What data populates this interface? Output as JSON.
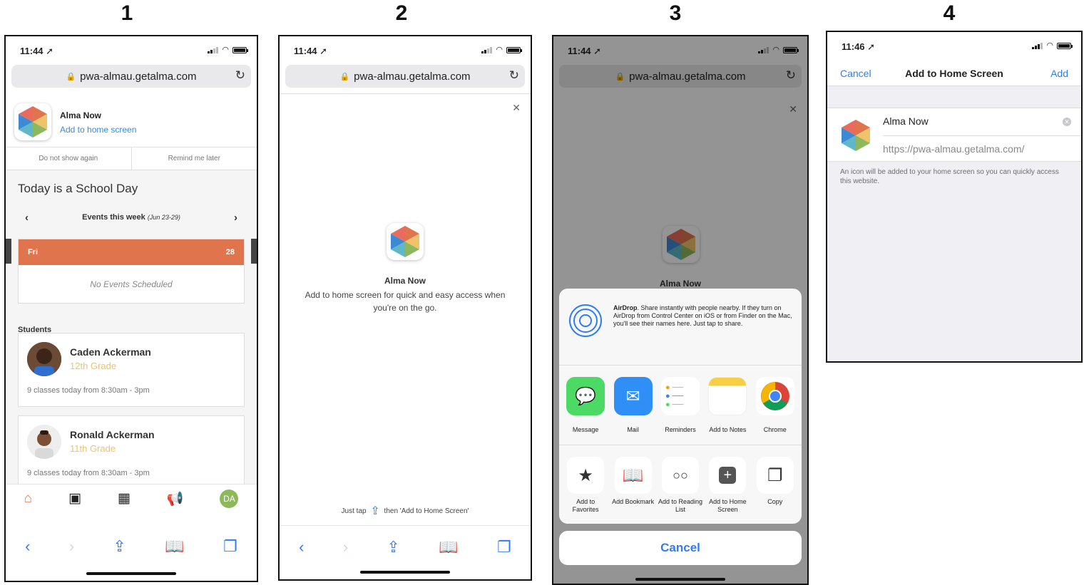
{
  "steps": [
    "1",
    "2",
    "3",
    "4"
  ],
  "common": {
    "url": "pwa-almau.getalma.com",
    "app_name": "Alma Now"
  },
  "phone1": {
    "time": "11:44 ➚",
    "banner_title": "Alma Now",
    "banner_subtitle": "Add to home screen",
    "dont_show": "Do not show again",
    "remind_later": "Remind me later",
    "today_text": "Today is a School Day",
    "events_label": "Events this week",
    "events_range": "(Jun 23-29)",
    "day_name": "Fri",
    "day_num": "28",
    "no_events": "No Events Scheduled",
    "students_label": "Students",
    "students": [
      {
        "name": "Caden Ackerman",
        "grade": "12th Grade",
        "classes": "9 classes today from 8:30am - 3pm"
      },
      {
        "name": "Ronald Ackerman",
        "grade": "11th Grade",
        "classes": "9 classes today from 8:30am - 3pm"
      }
    ],
    "avatar_initials": "DA"
  },
  "phone2": {
    "time": "11:44 ➚",
    "title": "Alma Now",
    "description": "Add to home screen for quick and easy access when you're on the go.",
    "hint_before": "Just tap",
    "hint_after": "then 'Add to Home Screen'"
  },
  "phone3": {
    "time": "11:44 ➚",
    "title": "Alma Now",
    "airdrop_bold": "AirDrop",
    "airdrop_text": ". Share instantly with people nearby. If they turn on AirDrop from Control Center on iOS or from Finder on the Mac, you'll see their names here. Just tap to share.",
    "apps": [
      "Message",
      "Mail",
      "Reminders",
      "Add to Notes",
      "Chrome"
    ],
    "actions": [
      "Add to Favorites",
      "Add Bookmark",
      "Add to Reading List",
      "Add to Home Screen",
      "Copy"
    ],
    "cancel": "Cancel"
  },
  "phone4": {
    "time": "11:46 ➚",
    "cancel": "Cancel",
    "title": "Add to Home Screen",
    "add": "Add",
    "name_value": "Alma Now",
    "url_value": "https://pwa-almau.getalma.com/",
    "note": "An icon will be added to your home screen so you can quickly access this website."
  },
  "colors": {
    "accent": "#2f7cf6",
    "day_header": "#e0744c",
    "grade": "#f0c36a"
  }
}
